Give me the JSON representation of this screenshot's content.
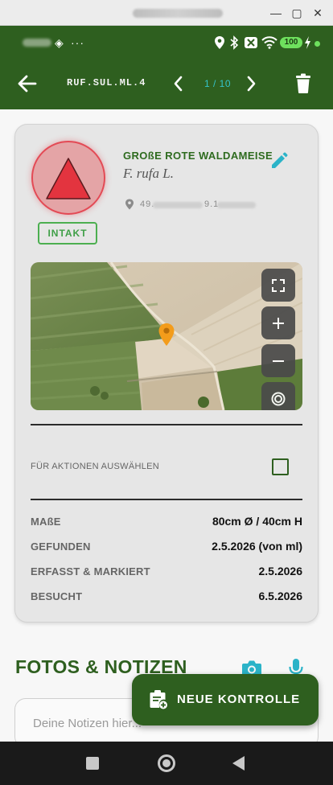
{
  "window": {
    "controls": {
      "minimize": "—",
      "maximize": "▢",
      "close": "✕"
    }
  },
  "statusbar": {
    "overflow": "···",
    "battery": "100",
    "icons": [
      "location-icon",
      "bluetooth-icon",
      "mobile-data-off-icon",
      "wifi-icon",
      "battery-icon",
      "charging-icon"
    ]
  },
  "appbar": {
    "identifier": "RUF.SUL.ML.4",
    "pager": "1 / 10",
    "colors": {
      "background": "#2e5f1f",
      "pager": "#35c3c9"
    }
  },
  "nest": {
    "status": "INTAKT",
    "species_common": "GROßE ROTE WALDAMEISE",
    "species_latin": "F. rufa L.",
    "coords_lat_prefix": "49.",
    "coords_lon_prefix": "9.1",
    "status_color": "#e34a55"
  },
  "selection": {
    "label": "FÜR AKTIONEN AUSWÄHLEN",
    "checked": false
  },
  "details": [
    {
      "label": "MAßE",
      "value": "80cm Ø / 40cm H"
    },
    {
      "label": "GEFUNDEN",
      "value": "2.5.2026 (von ml)"
    },
    {
      "label": "ERFASST & MARKIERT",
      "value": "2.5.2026"
    },
    {
      "label": "BESUCHT",
      "value": "6.5.2026"
    }
  ],
  "photos_notes": {
    "title": "FOTOS & NOTIZEN",
    "notes_placeholder": "Deine Notizen hier..."
  },
  "fab": {
    "label": "NEUE KONTROLLE"
  }
}
